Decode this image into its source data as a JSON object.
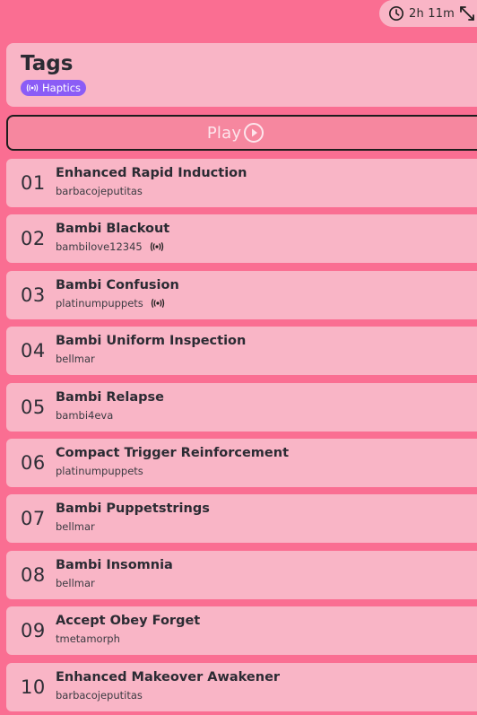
{
  "header": {
    "duration": "2h 11m",
    "title": "Tags",
    "badge": "Haptics"
  },
  "play": {
    "label": "Play"
  },
  "icons": {
    "clock": "clock-icon",
    "expand": "expand-icon",
    "haptics": "haptics-icon",
    "play": "play-circle-icon"
  },
  "colors": {
    "background": "#fa6e92",
    "card": "#f9b5c6",
    "badge": "#8b5cf6",
    "play_button": "#f6879f"
  },
  "tracks": [
    {
      "num": "01",
      "title": "Enhanced Rapid Induction",
      "author": "barbacojeputitas",
      "haptics": false
    },
    {
      "num": "02",
      "title": "Bambi Blackout",
      "author": "bambilove12345",
      "haptics": true
    },
    {
      "num": "03",
      "title": "Bambi Confusion",
      "author": "platinumpuppets",
      "haptics": true
    },
    {
      "num": "04",
      "title": "Bambi Uniform Inspection",
      "author": "bellmar",
      "haptics": false
    },
    {
      "num": "05",
      "title": "Bambi Relapse",
      "author": "bambi4eva",
      "haptics": false
    },
    {
      "num": "06",
      "title": "Compact Trigger Reinforcement",
      "author": "platinumpuppets",
      "haptics": false
    },
    {
      "num": "07",
      "title": "Bambi Puppetstrings",
      "author": "bellmar",
      "haptics": false
    },
    {
      "num": "08",
      "title": "Bambi Insomnia",
      "author": "bellmar",
      "haptics": false
    },
    {
      "num": "09",
      "title": "Accept Obey Forget",
      "author": "tmetamorph",
      "haptics": false
    },
    {
      "num": "10",
      "title": "Enhanced Makeover Awakener",
      "author": "barbacojeputitas",
      "haptics": false
    }
  ]
}
